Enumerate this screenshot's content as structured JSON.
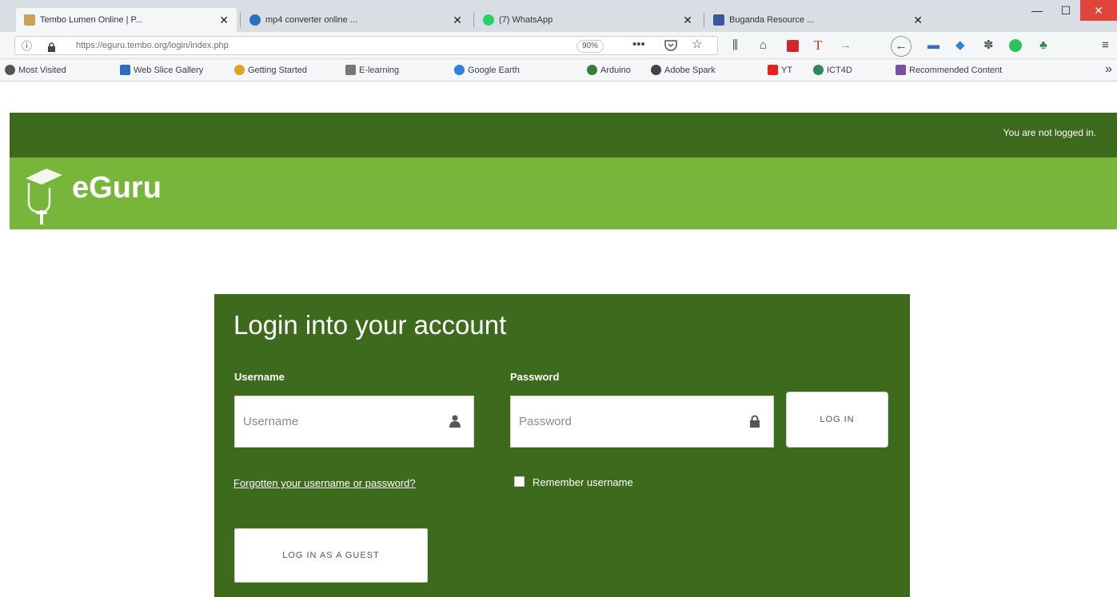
{
  "browser": {
    "tabs": [
      {
        "title": "Tembo Lumen Online | P...",
        "favicon_color": "#c7a35a",
        "active": true
      },
      {
        "title": "mp4 converter online ...",
        "favicon_color": "#2d6fbf",
        "active": false
      },
      {
        "title": "(7) WhatsApp",
        "favicon_color": "#25d366",
        "active": false
      },
      {
        "title": "Buganda Resource ...",
        "favicon_color": "#3b5998",
        "active": false
      }
    ],
    "tab_close_glyph": "✕",
    "window_controls": {
      "minimize": "—",
      "maximize": "☐",
      "close": "✕"
    },
    "url": "https://eguru.tembo.org/login/index.php",
    "zoom": "90%",
    "bookmarks": [
      {
        "label": "Most Visited",
        "icon_color": "#555555"
      },
      {
        "label": "Web Slice Gallery",
        "icon_color": "#2d6fbf"
      },
      {
        "label": "Getting Started",
        "icon_color": "#e6a020"
      },
      {
        "label": "E-learning",
        "icon_color": "#777777"
      },
      {
        "label": "Google Earth",
        "icon_color": "#2f7fe0"
      },
      {
        "label": "Arduino",
        "icon_color": "#3a7a3a"
      },
      {
        "label": "Adobe Spark",
        "icon_color": "#444444"
      },
      {
        "label": "YT",
        "icon_color": "#e62117"
      },
      {
        "label": "ICT4D",
        "icon_color": "#2e8b57"
      },
      {
        "label": "Recommended Content",
        "icon_color": "#7a4ea0"
      }
    ],
    "bookmarks_overflow": "»"
  },
  "site": {
    "login_status": "You are not logged in.",
    "brand": "eGuru",
    "colors": {
      "dark_green": "#3d6a1c",
      "light_green": "#77b63b",
      "white": "#ffffff"
    }
  },
  "login": {
    "title": "Login into your account",
    "username_label": "Username",
    "username_placeholder": "Username",
    "password_label": "Password",
    "password_placeholder": "Password",
    "login_button": "LOG IN",
    "forgot_link": "Forgotten your username or password?",
    "remember_label": "Remember username",
    "remember_checked": false,
    "guest_button": "LOG IN AS A GUEST"
  }
}
